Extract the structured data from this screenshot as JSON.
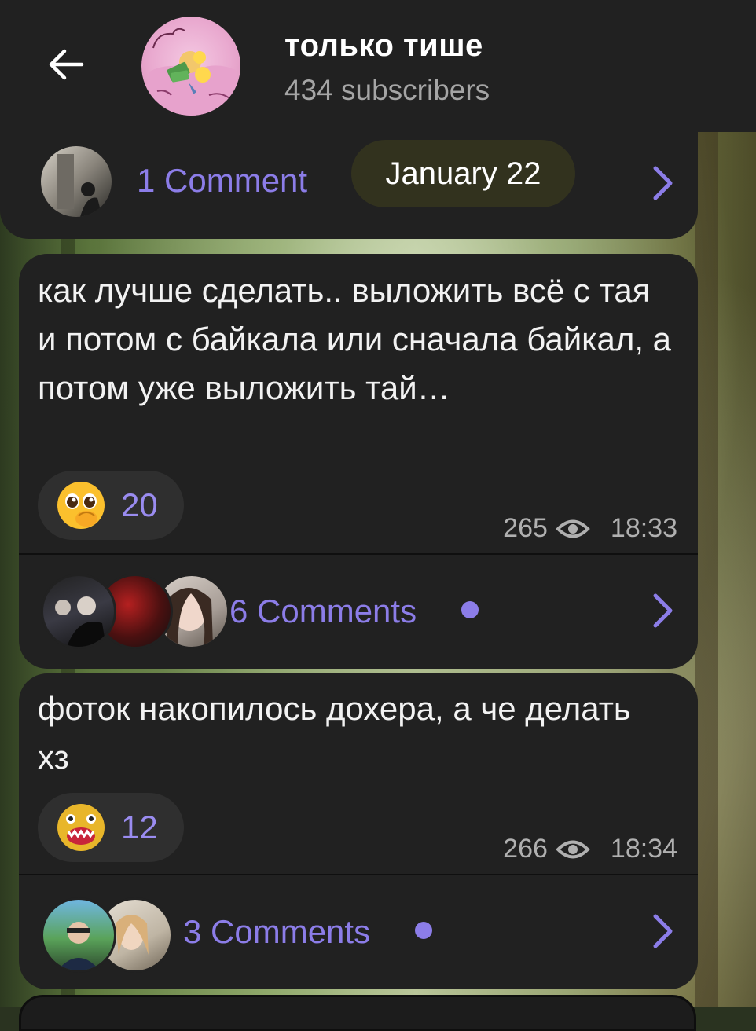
{
  "header": {
    "title": "только тише",
    "subscribers": "434 subscribers"
  },
  "top_post": {
    "comments_label": "1 Comment",
    "date_chip": "January 22"
  },
  "posts": [
    {
      "text": "как лучше сделать.. выложить всё с тая и потом с байкала или сначала байкал, а потом уже выложить тай…",
      "reaction_count": "20",
      "views": "265",
      "time": "18:33",
      "comments_label": "6 Comments"
    },
    {
      "text": "фоток накопилось дохера, а че делать хз",
      "reaction_count": "12",
      "views": "266",
      "time": "18:34",
      "comments_label": "3 Comments"
    }
  ],
  "colors": {
    "bubble": "#212121",
    "accent": "#8c7de8",
    "header": "#212121",
    "date_chip": "#32321e"
  },
  "icons": [
    "back-arrow-icon",
    "eye-icon",
    "chevron-right-icon",
    "unread-dot-icon"
  ]
}
